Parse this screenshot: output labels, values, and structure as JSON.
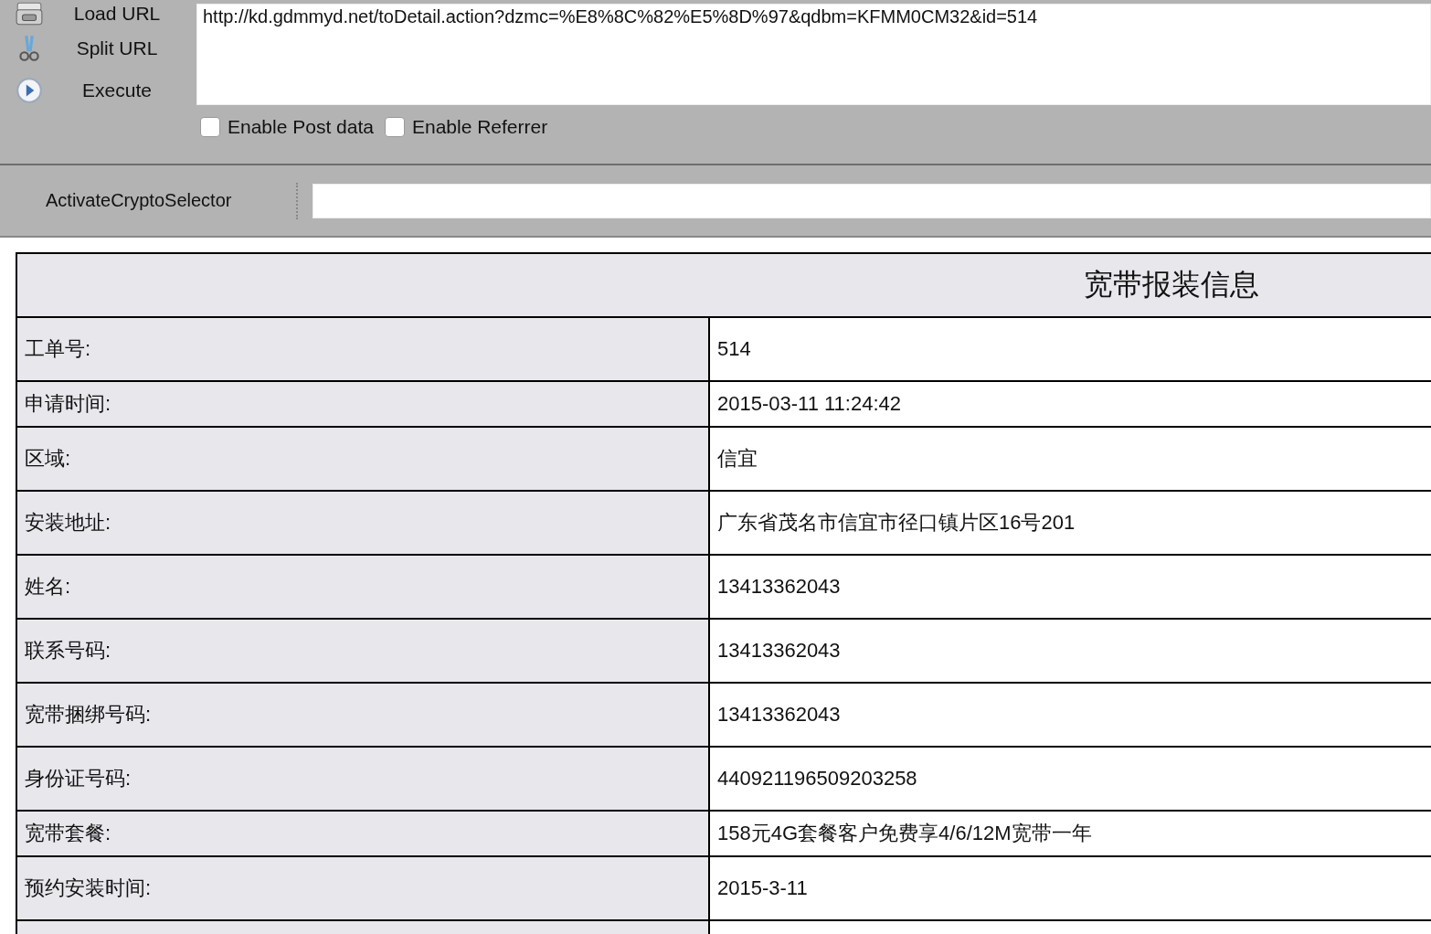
{
  "toolbar": {
    "buttons": [
      {
        "kind": "load",
        "label": "Load URL"
      },
      {
        "kind": "split",
        "label": "Split URL"
      },
      {
        "kind": "execute",
        "label": "Execute"
      }
    ],
    "url": "http://kd.gdmmyd.net/toDetail.action?dzmc=%E8%8C%82%E5%8D%97&qdbm=KFMM0CM32&id=514",
    "options": [
      {
        "label": "Enable Post data",
        "checked": false
      },
      {
        "label": "Enable Referrer",
        "checked": false
      }
    ]
  },
  "crypto_bar": {
    "label": "ActivateCryptoSelector"
  },
  "table": {
    "title": "宽带报装信息",
    "rows": [
      {
        "label": "工单号:",
        "value": "514"
      },
      {
        "label": "申请时间:",
        "value": "2015-03-11 11:24:42"
      },
      {
        "label": "区域:",
        "value": "信宜"
      },
      {
        "label": "安装地址:",
        "value": "广东省茂名市信宜市径口镇片区16号201"
      },
      {
        "label": "姓名:",
        "value": "13413362043"
      },
      {
        "label": "联系号码:",
        "value": "13413362043"
      },
      {
        "label": "宽带捆绑号码:",
        "value": "13413362043"
      },
      {
        "label": "身份证号码:",
        "value": "440921196509203258"
      },
      {
        "label": "宽带套餐:",
        "value": "158元4G套餐客户免费享4/6/12M宽带一年"
      },
      {
        "label": "预约安装时间:",
        "value": "2015-3-11"
      }
    ]
  }
}
